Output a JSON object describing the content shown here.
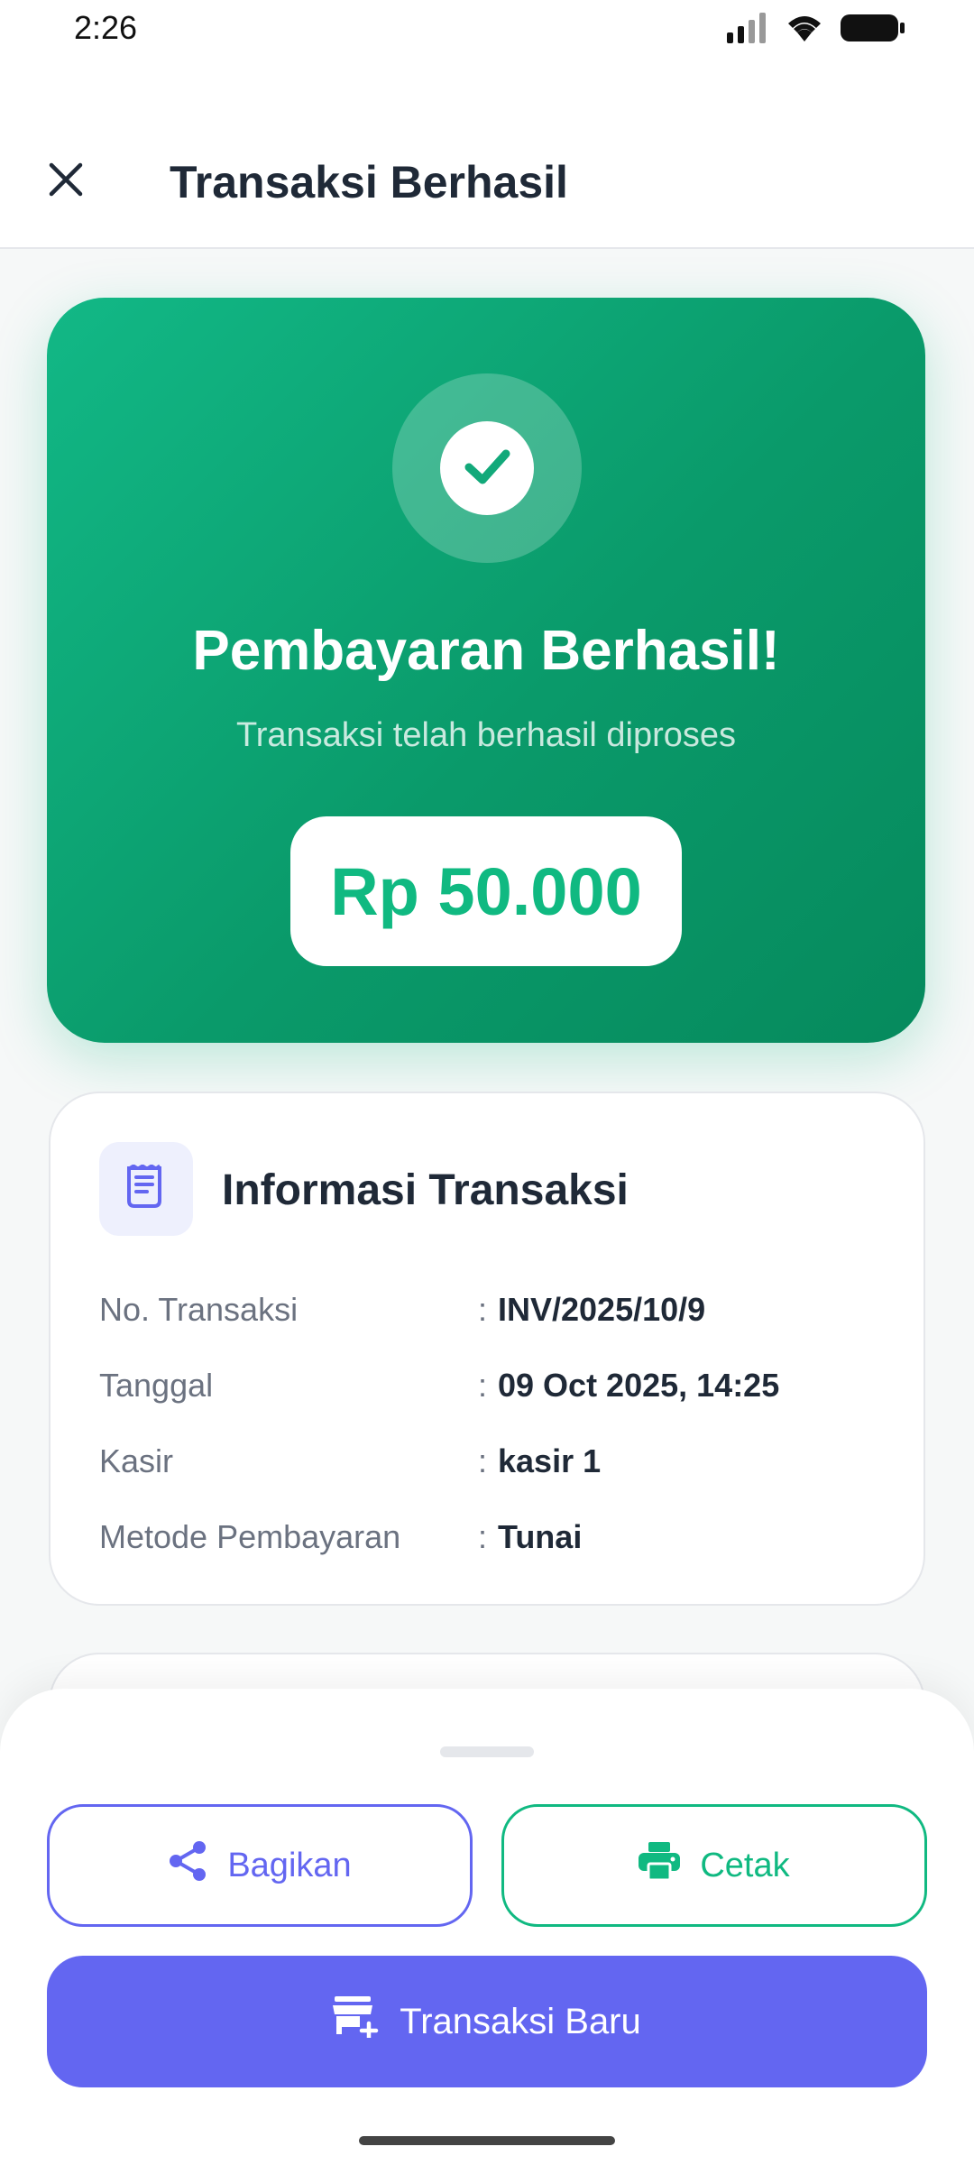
{
  "status_bar": {
    "time": "2:26",
    "icons": [
      "signal-icon",
      "wifi-icon",
      "battery-icon"
    ]
  },
  "app_bar": {
    "title": "Transaksi Berhasil",
    "close_icon": "close-icon"
  },
  "success": {
    "title": "Pembayaran Berhasil!",
    "subtitle": "Transaksi telah berhasil diproses",
    "amount": "Rp 50.000",
    "icon": "check-icon"
  },
  "info": {
    "title": "Informasi Transaksi",
    "icon": "receipt-icon",
    "colon": ":",
    "rows": [
      {
        "label": "No. Transaksi",
        "value": "INV/2025/10/9"
      },
      {
        "label": "Tanggal",
        "value": "09 Oct 2025, 14:25"
      },
      {
        "label": "Kasir",
        "value": "kasir 1"
      },
      {
        "label": "Metode Pembayaran",
        "value": "Tunai"
      }
    ]
  },
  "actions": {
    "share_label": "Bagikan",
    "print_label": "Cetak",
    "new_label": "Transaksi Baru"
  },
  "colors": {
    "primary": "#6366f1",
    "success": "#10b981",
    "success_dark": "#068a5d",
    "text": "#1f2937",
    "muted": "#6b7280"
  }
}
